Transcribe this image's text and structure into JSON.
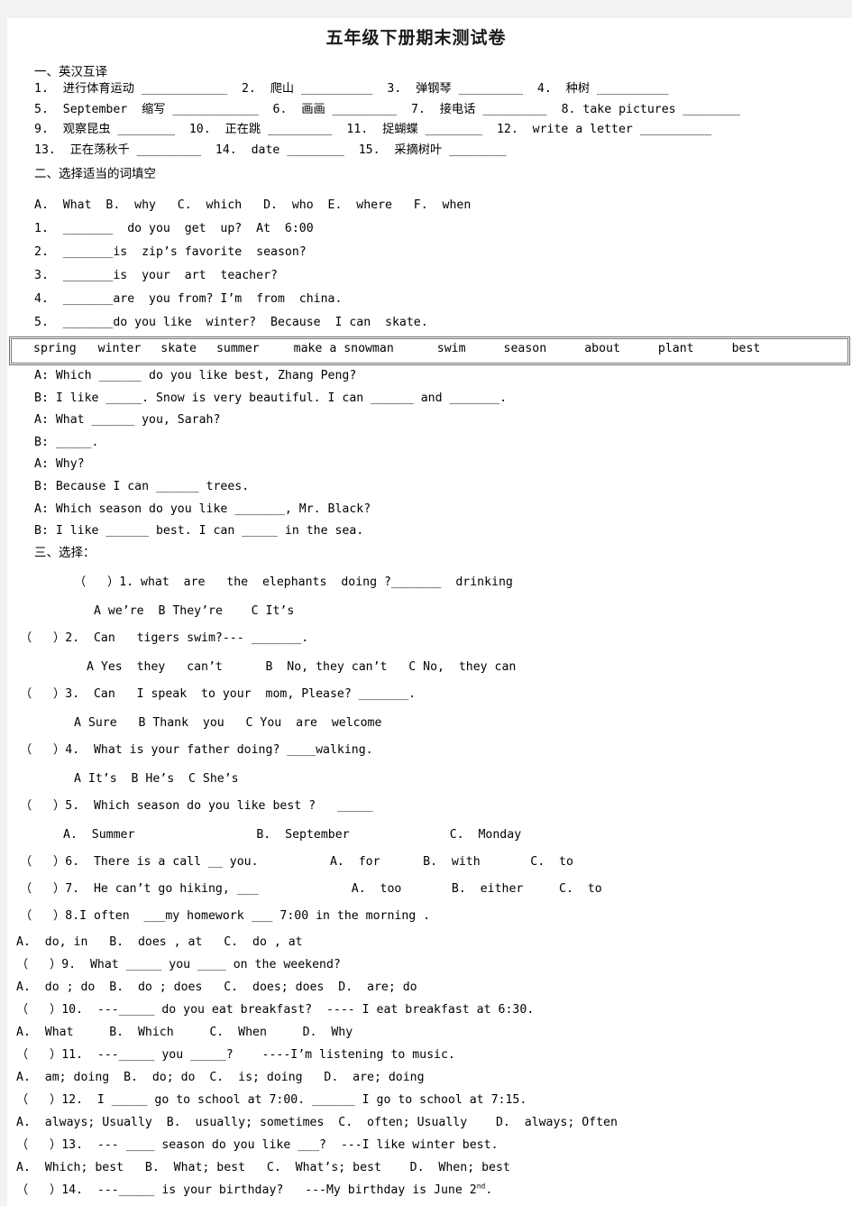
{
  "document": {
    "title": "五年级下册期末测试卷"
  },
  "section1": {
    "heading": "一、英汉互译",
    "lines": [
      "1.  进行体育运动 ____________  2.  爬山 __________  3.  弹钢琴 _________  4.  种树 __________",
      "5.  September  缩写 ____________  6.  画画 _________  7.  接电话 _________  8. take pictures ________",
      "9.  观察昆虫 ________  10.  正在跳 _________  11.  捉蝴蝶 ________  12.  write a letter __________",
      "13.  正在荡秋千 _________  14.  date ________  15.  采摘树叶 ________"
    ]
  },
  "section2": {
    "heading": "二、选择适当的词填空",
    "options_line": "A.  What  B.  why   C.  which   D.  who  E.  where   F.  when",
    "questions": [
      "1.  _______  do you  get  up?  At  6:00",
      "2.  _______is  zip’s favorite  season?",
      "3.  _______is  your  art  teacher?",
      "4.  _______are  you from? I’m  from  china.",
      "5.  _______do you like  winter?  Because  I can  skate."
    ],
    "word_bank": [
      "spring",
      "winter",
      "skate",
      "summer",
      "make a snowman",
      "swim",
      "season",
      "about",
      "plant",
      "best"
    ],
    "dialogue": [
      "A: Which ______ do you like best, Zhang Peng?",
      "B: I like _____. Snow is very beautiful. I can ______ and _______.",
      "A: What ______ you, Sarah?",
      "B: _____.",
      "A: Why?",
      "B: Because I can ______ trees.",
      "A: Which season do you like _______, Mr. Black?",
      "B: I like ______ best. I can _____ in the sea."
    ]
  },
  "section3": {
    "heading": "三、选择：",
    "items": [
      {
        "question": "（   ）1. what  are   the  elephants  doing ?_______  drinking",
        "answers": "A we’re  B They’re    C It’s",
        "layout": "indented"
      },
      {
        "question": "（   ）2.  Can   tigers swim?--- _______.",
        "answers": "A Yes  they   can’t      B  No, they can’t   C No,  they can",
        "layout": "normal"
      },
      {
        "question": "（   ）3.  Can   I speak  to your  mom, Please? _______.",
        "answers": "A Sure   B Thank  you   C You  are  welcome",
        "layout": "normal"
      },
      {
        "question": "（   ）4.  What is your father doing? ____walking.",
        "answers": "A It’s  B He’s  C She’s",
        "layout": "normal"
      },
      {
        "question": "（   ）5.  Which season do you like best ?   _____",
        "answers": "A.  Summer                 B.  September              C.  Monday",
        "layout": "wide"
      },
      {
        "question": "（   ）6.  There is a call __ you.          A.  for      B.  with       C.  to",
        "answers": "",
        "layout": "inline"
      },
      {
        "question": "（   ）7.  He can’t go hiking, ___             A.  too       B.  either     C.  to",
        "answers": "",
        "layout": "inline"
      },
      {
        "question": "（   ）8.I often  ___my homework ___ 7:00 in the morning .",
        "answers": "A.  do, in   B.  does , at   C.  do , at",
        "layout": "tight"
      },
      {
        "question": "（   ）9.  What _____ you ____ on the weekend?",
        "answers": "A.  do ; do  B.  do ; does   C.  does; does  D.  are; do",
        "layout": "tight"
      },
      {
        "question": "（   ）10.  ---_____ do you eat breakfast?  ---- I eat breakfast at 6:30.",
        "answers": "A.  What     B.  Which     C.  When     D.  Why",
        "layout": "tight"
      },
      {
        "question": "（   ）11.  ---_____ you _____?    ----I’m listening to music.",
        "answers": "A.  am; doing  B.  do; do  C.  is; doing   D.  are; doing",
        "layout": "tight"
      },
      {
        "question": "（   ）12.  I _____ go to school at 7:00. ______ I go to school at 7:15.",
        "answers": "A.  always; Usually  B.  usually; sometimes  C.  often; Usually    D.  always; Often",
        "layout": "tight"
      },
      {
        "question": "（   ）13.  --- ____ season do you like ___?  ---I like winter best.",
        "answers": "A.  Which; best   B.  What; best   C.  What’s; best    D.  When; best",
        "layout": "tight"
      }
    ],
    "last_item": {
      "prefix": "（   ）14.  ---_____ is your birthday?   ---My birthday is June 2",
      "superscript": "nd",
      "suffix": "."
    }
  }
}
